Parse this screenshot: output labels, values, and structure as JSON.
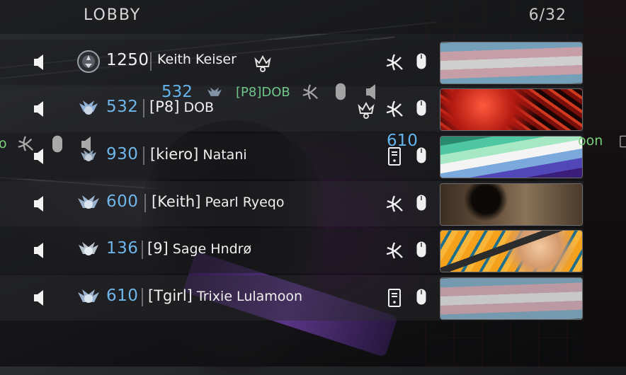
{
  "lobby": {
    "title": "LOBBY",
    "count": "6/32"
  },
  "players": [
    {
      "level": "1250",
      "level_color": "white",
      "clan": "",
      "name": "Keith Keiser",
      "host": true,
      "platform": "battlenet",
      "input": "mouse",
      "calling": "trans-flag"
    },
    {
      "level": "532",
      "level_color": "blue",
      "clan": "[P8]",
      "name": "DOB",
      "host": true,
      "platform": "battlenet",
      "input": "mouse",
      "calling": "red-abstract"
    },
    {
      "level": "930",
      "level_color": "blue",
      "clan": "[kiero]",
      "name": "Natani",
      "host": false,
      "platform": "pc",
      "input": "mouse",
      "calling": "gay-men-flag"
    },
    {
      "level": "600",
      "level_color": "blue",
      "clan": "[Keith]",
      "name": "Pearl Ryeqo",
      "host": false,
      "platform": "battlenet",
      "input": "mouse",
      "calling": "horror-hallway"
    },
    {
      "level": "136",
      "level_color": "blue",
      "clan": "[9]",
      "name": "Sage Hndrø",
      "host": false,
      "platform": "battlenet",
      "input": "mouse",
      "calling": "comic-soldier"
    },
    {
      "level": "610",
      "level_color": "blue",
      "clan": "[Tgirl]",
      "name": "Trixie Lulamoon",
      "host": false,
      "platform": "pc",
      "input": "mouse",
      "calling": "trans-flag"
    }
  ],
  "ghost": {
    "level": "532",
    "name": "[P8]DOB",
    "left_fragment": "o",
    "level_right": "610",
    "right_fragment": "oon"
  },
  "colors": {
    "level_blue": "#6fb6ea",
    "level_white": "#f2f2f2",
    "ghost_green": "#6fc58a"
  }
}
